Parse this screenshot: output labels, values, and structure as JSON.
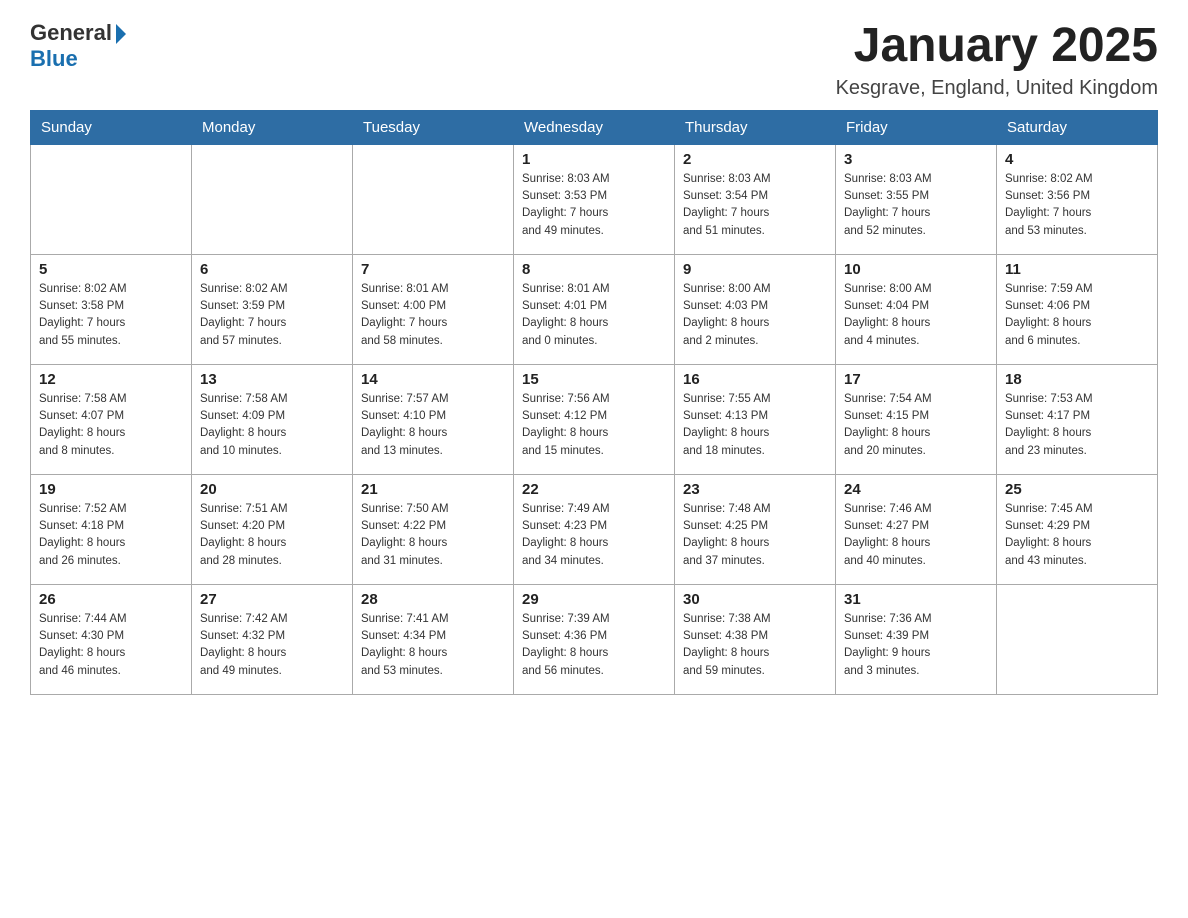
{
  "header": {
    "logo": {
      "text_general": "General",
      "text_blue": "Blue"
    },
    "title": "January 2025",
    "location": "Kesgrave, England, United Kingdom"
  },
  "days_of_week": [
    "Sunday",
    "Monday",
    "Tuesday",
    "Wednesday",
    "Thursday",
    "Friday",
    "Saturday"
  ],
  "weeks": [
    [
      {
        "day": "",
        "info": ""
      },
      {
        "day": "",
        "info": ""
      },
      {
        "day": "",
        "info": ""
      },
      {
        "day": "1",
        "info": "Sunrise: 8:03 AM\nSunset: 3:53 PM\nDaylight: 7 hours\nand 49 minutes."
      },
      {
        "day": "2",
        "info": "Sunrise: 8:03 AM\nSunset: 3:54 PM\nDaylight: 7 hours\nand 51 minutes."
      },
      {
        "day": "3",
        "info": "Sunrise: 8:03 AM\nSunset: 3:55 PM\nDaylight: 7 hours\nand 52 minutes."
      },
      {
        "day": "4",
        "info": "Sunrise: 8:02 AM\nSunset: 3:56 PM\nDaylight: 7 hours\nand 53 minutes."
      }
    ],
    [
      {
        "day": "5",
        "info": "Sunrise: 8:02 AM\nSunset: 3:58 PM\nDaylight: 7 hours\nand 55 minutes."
      },
      {
        "day": "6",
        "info": "Sunrise: 8:02 AM\nSunset: 3:59 PM\nDaylight: 7 hours\nand 57 minutes."
      },
      {
        "day": "7",
        "info": "Sunrise: 8:01 AM\nSunset: 4:00 PM\nDaylight: 7 hours\nand 58 minutes."
      },
      {
        "day": "8",
        "info": "Sunrise: 8:01 AM\nSunset: 4:01 PM\nDaylight: 8 hours\nand 0 minutes."
      },
      {
        "day": "9",
        "info": "Sunrise: 8:00 AM\nSunset: 4:03 PM\nDaylight: 8 hours\nand 2 minutes."
      },
      {
        "day": "10",
        "info": "Sunrise: 8:00 AM\nSunset: 4:04 PM\nDaylight: 8 hours\nand 4 minutes."
      },
      {
        "day": "11",
        "info": "Sunrise: 7:59 AM\nSunset: 4:06 PM\nDaylight: 8 hours\nand 6 minutes."
      }
    ],
    [
      {
        "day": "12",
        "info": "Sunrise: 7:58 AM\nSunset: 4:07 PM\nDaylight: 8 hours\nand 8 minutes."
      },
      {
        "day": "13",
        "info": "Sunrise: 7:58 AM\nSunset: 4:09 PM\nDaylight: 8 hours\nand 10 minutes."
      },
      {
        "day": "14",
        "info": "Sunrise: 7:57 AM\nSunset: 4:10 PM\nDaylight: 8 hours\nand 13 minutes."
      },
      {
        "day": "15",
        "info": "Sunrise: 7:56 AM\nSunset: 4:12 PM\nDaylight: 8 hours\nand 15 minutes."
      },
      {
        "day": "16",
        "info": "Sunrise: 7:55 AM\nSunset: 4:13 PM\nDaylight: 8 hours\nand 18 minutes."
      },
      {
        "day": "17",
        "info": "Sunrise: 7:54 AM\nSunset: 4:15 PM\nDaylight: 8 hours\nand 20 minutes."
      },
      {
        "day": "18",
        "info": "Sunrise: 7:53 AM\nSunset: 4:17 PM\nDaylight: 8 hours\nand 23 minutes."
      }
    ],
    [
      {
        "day": "19",
        "info": "Sunrise: 7:52 AM\nSunset: 4:18 PM\nDaylight: 8 hours\nand 26 minutes."
      },
      {
        "day": "20",
        "info": "Sunrise: 7:51 AM\nSunset: 4:20 PM\nDaylight: 8 hours\nand 28 minutes."
      },
      {
        "day": "21",
        "info": "Sunrise: 7:50 AM\nSunset: 4:22 PM\nDaylight: 8 hours\nand 31 minutes."
      },
      {
        "day": "22",
        "info": "Sunrise: 7:49 AM\nSunset: 4:23 PM\nDaylight: 8 hours\nand 34 minutes."
      },
      {
        "day": "23",
        "info": "Sunrise: 7:48 AM\nSunset: 4:25 PM\nDaylight: 8 hours\nand 37 minutes."
      },
      {
        "day": "24",
        "info": "Sunrise: 7:46 AM\nSunset: 4:27 PM\nDaylight: 8 hours\nand 40 minutes."
      },
      {
        "day": "25",
        "info": "Sunrise: 7:45 AM\nSunset: 4:29 PM\nDaylight: 8 hours\nand 43 minutes."
      }
    ],
    [
      {
        "day": "26",
        "info": "Sunrise: 7:44 AM\nSunset: 4:30 PM\nDaylight: 8 hours\nand 46 minutes."
      },
      {
        "day": "27",
        "info": "Sunrise: 7:42 AM\nSunset: 4:32 PM\nDaylight: 8 hours\nand 49 minutes."
      },
      {
        "day": "28",
        "info": "Sunrise: 7:41 AM\nSunset: 4:34 PM\nDaylight: 8 hours\nand 53 minutes."
      },
      {
        "day": "29",
        "info": "Sunrise: 7:39 AM\nSunset: 4:36 PM\nDaylight: 8 hours\nand 56 minutes."
      },
      {
        "day": "30",
        "info": "Sunrise: 7:38 AM\nSunset: 4:38 PM\nDaylight: 8 hours\nand 59 minutes."
      },
      {
        "day": "31",
        "info": "Sunrise: 7:36 AM\nSunset: 4:39 PM\nDaylight: 9 hours\nand 3 minutes."
      },
      {
        "day": "",
        "info": ""
      }
    ]
  ]
}
